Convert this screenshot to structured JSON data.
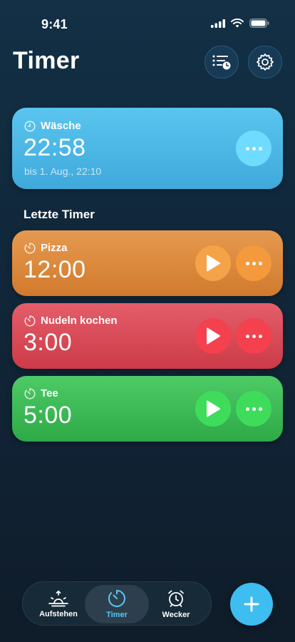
{
  "status_bar": {
    "time": "9:41"
  },
  "header": {
    "title": "Timer"
  },
  "active_timer": {
    "name": "Wäsche",
    "time": "22:58",
    "until": "bis 1. Aug., 22:10"
  },
  "recent": {
    "title": "Letzte Timer",
    "items": [
      {
        "name": "Pizza",
        "time": "12:00"
      },
      {
        "name": "Nudeln kochen",
        "time": "3:00"
      },
      {
        "name": "Tee",
        "time": "5:00"
      }
    ]
  },
  "tabs": [
    {
      "label": "Aufstehen",
      "icon": "sunrise-icon"
    },
    {
      "label": "Timer",
      "icon": "timer-icon",
      "selected": true
    },
    {
      "label": "Wecker",
      "icon": "alarm-clock-icon"
    }
  ],
  "colors": {
    "active": "#4ab7e6",
    "orange": "#dd8a3d",
    "red": "#d94a57",
    "green": "#3dba56",
    "accent": "#3dbdf0"
  }
}
